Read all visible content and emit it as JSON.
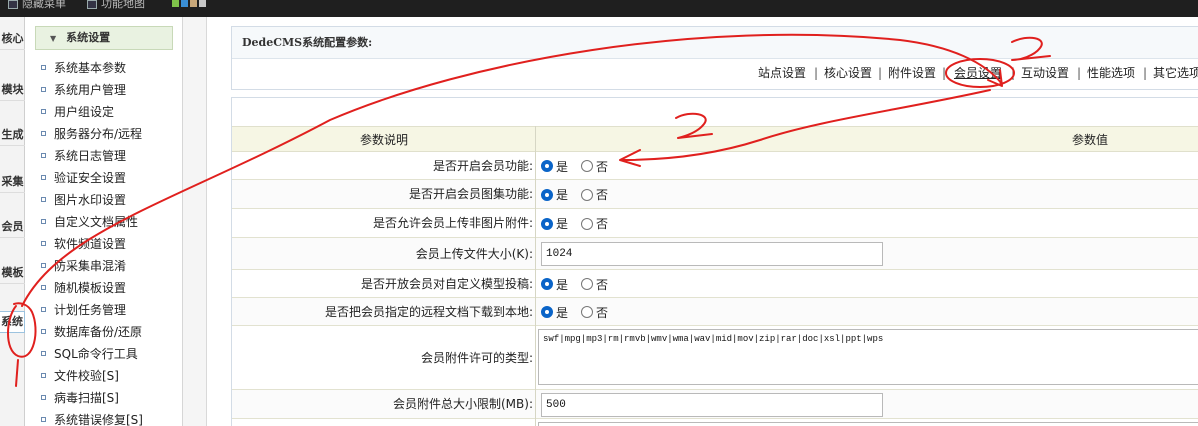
{
  "topbar": {
    "menu_label": "隐藏菜单",
    "map_label": "功能地图"
  },
  "vtabs": [
    "核心",
    "模块",
    "生成",
    "采集",
    "会员",
    "模板",
    "系统"
  ],
  "menu": {
    "header": "系统设置",
    "items": [
      "系统基本参数",
      "系统用户管理",
      "用户组设定",
      "服务器分布/远程",
      "系统日志管理",
      "验证安全设置",
      "图片水印设置",
      "自定义文档属性",
      "软件频道设置",
      "防采集串混淆",
      "随机模板设置",
      "计划任务管理",
      "数据库备份/还原",
      "SQL命令行工具",
      "文件校验[S]",
      "病毒扫描[S]",
      "系统错误修复[S]"
    ]
  },
  "main": {
    "title": "DedeCMS系统配置参数:",
    "tabs": [
      "站点设置",
      "核心设置",
      "附件设置",
      "会员设置",
      "互动设置",
      "性能选项",
      "其它选项"
    ],
    "active_tab": "会员设置",
    "table": {
      "col_label": "参数说明",
      "col_value": "参数值"
    },
    "options": {
      "yes": "是",
      "no": "否"
    },
    "rows": [
      {
        "label": "是否开启会员功能:",
        "type": "radio",
        "value": "是"
      },
      {
        "label": "是否开启会员图集功能:",
        "type": "radio",
        "value": "是"
      },
      {
        "label": "是否允许会员上传非图片附件:",
        "type": "radio",
        "value": "是"
      },
      {
        "label": "会员上传文件大小(K):",
        "type": "text",
        "value": "1024"
      },
      {
        "label": "是否开放会员对自定义模型投稿:",
        "type": "radio",
        "value": "是"
      },
      {
        "label": "是否把会员指定的远程文档下载到本地:",
        "type": "radio",
        "value": "是"
      },
      {
        "label": "会员附件许可的类型:",
        "type": "textarea",
        "value": "swf|mpg|mp3|rm|rmvb|wmv|wma|wav|mid|mov|zip|rar|doc|xsl|ppt|wps"
      },
      {
        "label": "会员附件总大小限制(MB):",
        "type": "text",
        "value": "500"
      }
    ]
  },
  "annotations": {
    "mark_1": "2",
    "mark_2": "2"
  }
}
